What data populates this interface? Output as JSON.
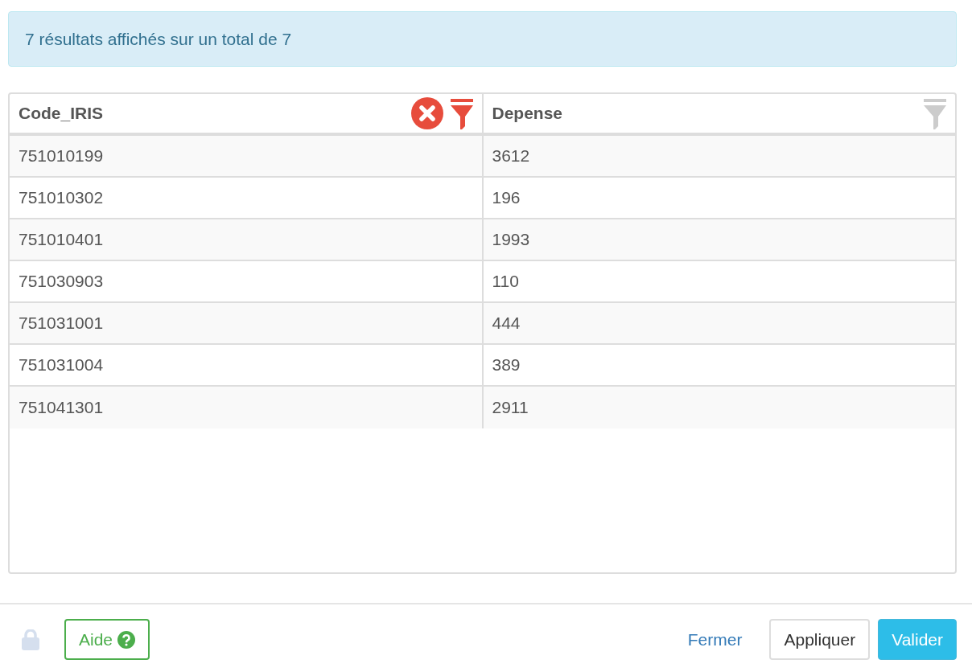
{
  "info": "7 résultats affichés sur un total de 7",
  "table": {
    "columns": [
      {
        "label": "Code_IRIS",
        "filtered": true
      },
      {
        "label": "Depense",
        "filtered": false
      }
    ],
    "rows": [
      [
        "751010199",
        "3612"
      ],
      [
        "751010302",
        "196"
      ],
      [
        "751010401",
        "1993"
      ],
      [
        "751030903",
        "110"
      ],
      [
        "751031001",
        "444"
      ],
      [
        "751031004",
        "389"
      ],
      [
        "751041301",
        "2911"
      ]
    ]
  },
  "footer": {
    "locked": true,
    "help": "Aide",
    "close": "Fermer",
    "apply": "Appliquer",
    "validate": "Valider"
  }
}
